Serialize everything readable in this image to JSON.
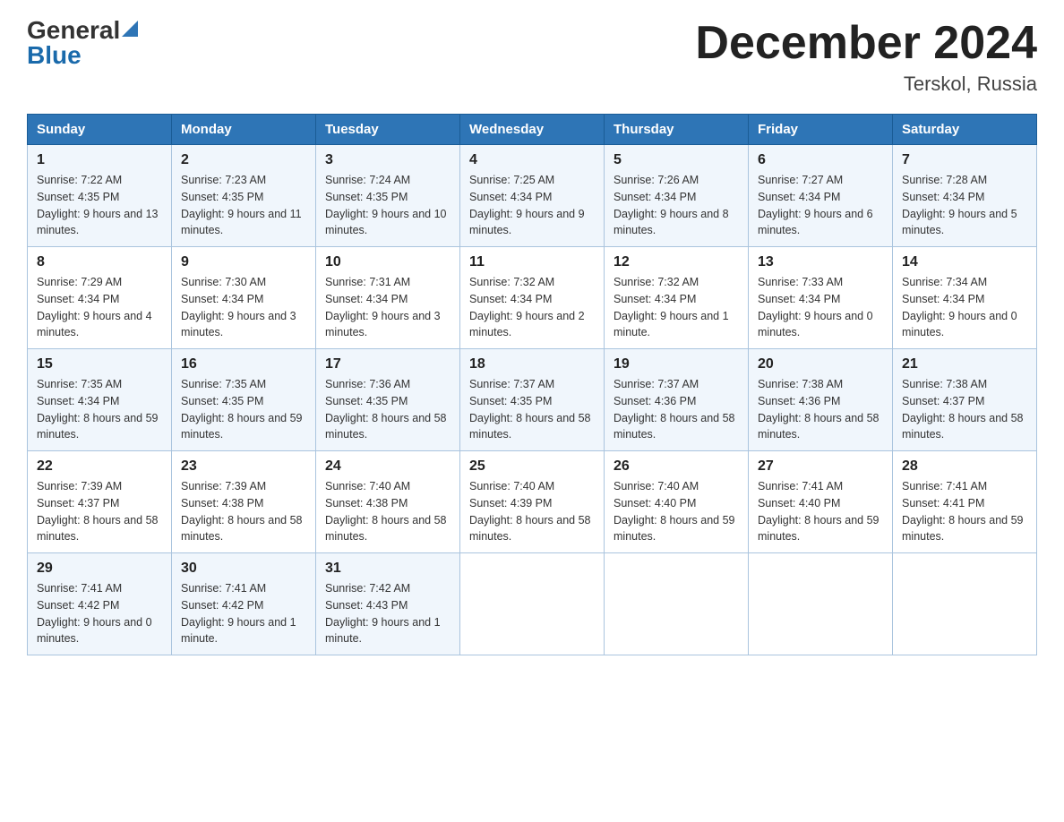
{
  "header": {
    "logo_general": "General",
    "logo_blue": "Blue",
    "month_title": "December 2024",
    "location": "Terskol, Russia"
  },
  "weekdays": [
    "Sunday",
    "Monday",
    "Tuesday",
    "Wednesday",
    "Thursday",
    "Friday",
    "Saturday"
  ],
  "weeks": [
    [
      {
        "day": "1",
        "sunrise": "7:22 AM",
        "sunset": "4:35 PM",
        "daylight": "9 hours and 13 minutes."
      },
      {
        "day": "2",
        "sunrise": "7:23 AM",
        "sunset": "4:35 PM",
        "daylight": "9 hours and 11 minutes."
      },
      {
        "day": "3",
        "sunrise": "7:24 AM",
        "sunset": "4:35 PM",
        "daylight": "9 hours and 10 minutes."
      },
      {
        "day": "4",
        "sunrise": "7:25 AM",
        "sunset": "4:34 PM",
        "daylight": "9 hours and 9 minutes."
      },
      {
        "day": "5",
        "sunrise": "7:26 AM",
        "sunset": "4:34 PM",
        "daylight": "9 hours and 8 minutes."
      },
      {
        "day": "6",
        "sunrise": "7:27 AM",
        "sunset": "4:34 PM",
        "daylight": "9 hours and 6 minutes."
      },
      {
        "day": "7",
        "sunrise": "7:28 AM",
        "sunset": "4:34 PM",
        "daylight": "9 hours and 5 minutes."
      }
    ],
    [
      {
        "day": "8",
        "sunrise": "7:29 AM",
        "sunset": "4:34 PM",
        "daylight": "9 hours and 4 minutes."
      },
      {
        "day": "9",
        "sunrise": "7:30 AM",
        "sunset": "4:34 PM",
        "daylight": "9 hours and 3 minutes."
      },
      {
        "day": "10",
        "sunrise": "7:31 AM",
        "sunset": "4:34 PM",
        "daylight": "9 hours and 3 minutes."
      },
      {
        "day": "11",
        "sunrise": "7:32 AM",
        "sunset": "4:34 PM",
        "daylight": "9 hours and 2 minutes."
      },
      {
        "day": "12",
        "sunrise": "7:32 AM",
        "sunset": "4:34 PM",
        "daylight": "9 hours and 1 minute."
      },
      {
        "day": "13",
        "sunrise": "7:33 AM",
        "sunset": "4:34 PM",
        "daylight": "9 hours and 0 minutes."
      },
      {
        "day": "14",
        "sunrise": "7:34 AM",
        "sunset": "4:34 PM",
        "daylight": "9 hours and 0 minutes."
      }
    ],
    [
      {
        "day": "15",
        "sunrise": "7:35 AM",
        "sunset": "4:34 PM",
        "daylight": "8 hours and 59 minutes."
      },
      {
        "day": "16",
        "sunrise": "7:35 AM",
        "sunset": "4:35 PM",
        "daylight": "8 hours and 59 minutes."
      },
      {
        "day": "17",
        "sunrise": "7:36 AM",
        "sunset": "4:35 PM",
        "daylight": "8 hours and 58 minutes."
      },
      {
        "day": "18",
        "sunrise": "7:37 AM",
        "sunset": "4:35 PM",
        "daylight": "8 hours and 58 minutes."
      },
      {
        "day": "19",
        "sunrise": "7:37 AM",
        "sunset": "4:36 PM",
        "daylight": "8 hours and 58 minutes."
      },
      {
        "day": "20",
        "sunrise": "7:38 AM",
        "sunset": "4:36 PM",
        "daylight": "8 hours and 58 minutes."
      },
      {
        "day": "21",
        "sunrise": "7:38 AM",
        "sunset": "4:37 PM",
        "daylight": "8 hours and 58 minutes."
      }
    ],
    [
      {
        "day": "22",
        "sunrise": "7:39 AM",
        "sunset": "4:37 PM",
        "daylight": "8 hours and 58 minutes."
      },
      {
        "day": "23",
        "sunrise": "7:39 AM",
        "sunset": "4:38 PM",
        "daylight": "8 hours and 58 minutes."
      },
      {
        "day": "24",
        "sunrise": "7:40 AM",
        "sunset": "4:38 PM",
        "daylight": "8 hours and 58 minutes."
      },
      {
        "day": "25",
        "sunrise": "7:40 AM",
        "sunset": "4:39 PM",
        "daylight": "8 hours and 58 minutes."
      },
      {
        "day": "26",
        "sunrise": "7:40 AM",
        "sunset": "4:40 PM",
        "daylight": "8 hours and 59 minutes."
      },
      {
        "day": "27",
        "sunrise": "7:41 AM",
        "sunset": "4:40 PM",
        "daylight": "8 hours and 59 minutes."
      },
      {
        "day": "28",
        "sunrise": "7:41 AM",
        "sunset": "4:41 PM",
        "daylight": "8 hours and 59 minutes."
      }
    ],
    [
      {
        "day": "29",
        "sunrise": "7:41 AM",
        "sunset": "4:42 PM",
        "daylight": "9 hours and 0 minutes."
      },
      {
        "day": "30",
        "sunrise": "7:41 AM",
        "sunset": "4:42 PM",
        "daylight": "9 hours and 1 minute."
      },
      {
        "day": "31",
        "sunrise": "7:42 AM",
        "sunset": "4:43 PM",
        "daylight": "9 hours and 1 minute."
      },
      null,
      null,
      null,
      null
    ]
  ]
}
